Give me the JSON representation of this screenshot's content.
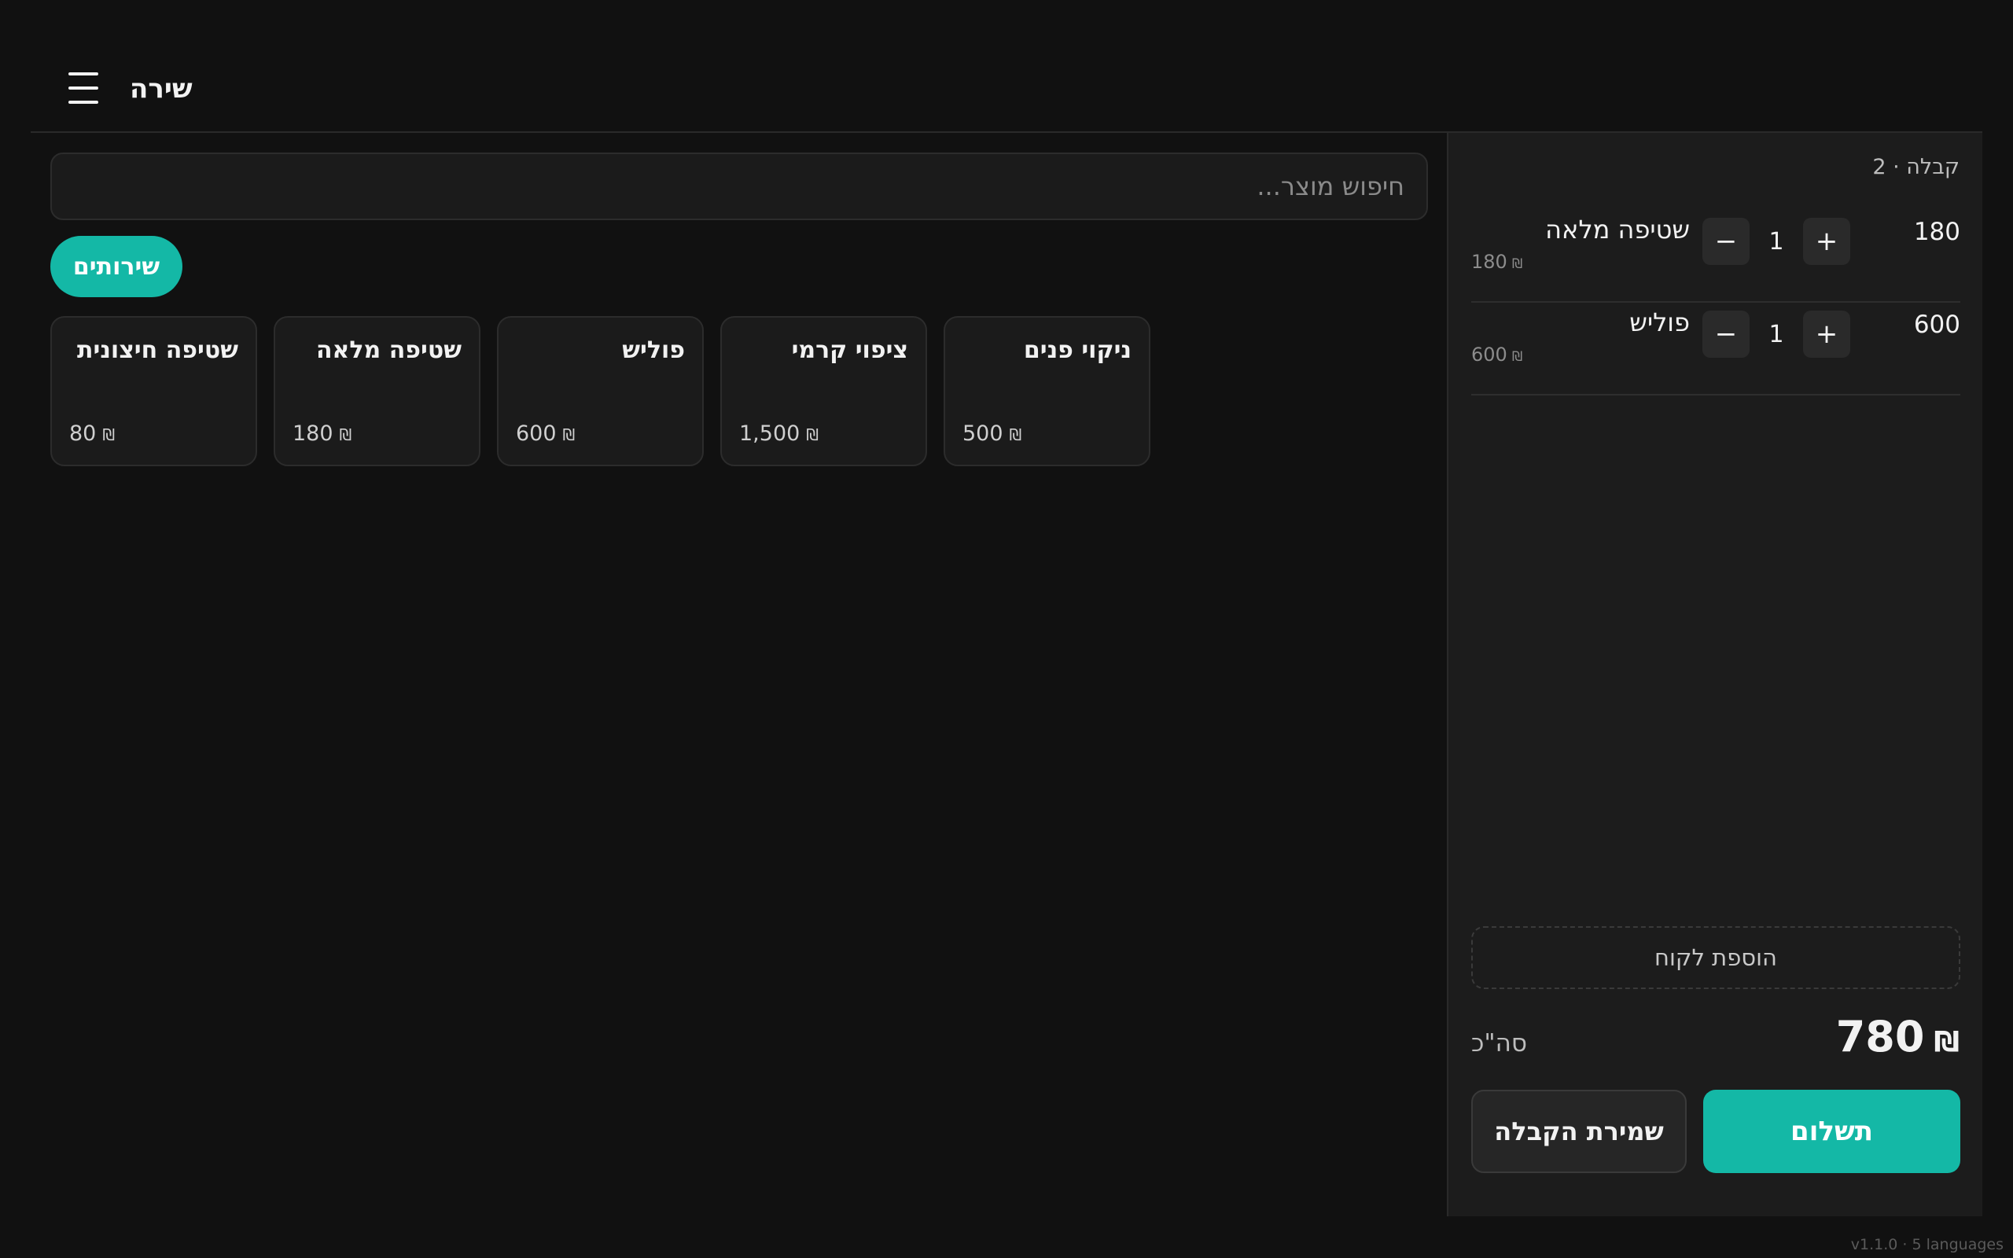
{
  "header": {
    "shop_name": "שירה"
  },
  "search": {
    "placeholder": "חיפוש מוצר..."
  },
  "categories": [
    {
      "label": "שירותים",
      "active": true
    }
  ],
  "products": [
    {
      "name": "ניקוי פנים",
      "price": "500",
      "currency": "₪"
    },
    {
      "name": "ציפוי קרמי",
      "price": "1,500",
      "currency": "₪"
    },
    {
      "name": "פוליש",
      "price": "600",
      "currency": "₪"
    },
    {
      "name": "שטיפה מלאה",
      "price": "180",
      "currency": "₪"
    },
    {
      "name": "שטיפה חיצונית",
      "price": "80",
      "currency": "₪"
    }
  ],
  "receipt": {
    "title": "קבלה · 2",
    "lines": [
      {
        "name": "שטיפה מלאה",
        "unit_price": "180",
        "currency": "₪",
        "qty": "1",
        "total": "180"
      },
      {
        "name": "פוליש",
        "unit_price": "600",
        "currency": "₪",
        "qty": "1",
        "total": "600"
      }
    ],
    "add_customer_label": "הוספת לקוח",
    "total_label": "סה\"כ",
    "total_value": "780",
    "total_currency": "₪",
    "save_label": "שמירת הקבלה",
    "pay_label": "תשלום",
    "minus_symbol": "−",
    "plus_symbol": "+"
  },
  "footer": {
    "version": "v1.1.0 · 5 languages"
  },
  "colors": {
    "accent": "#14b8a6",
    "background": "#111111",
    "panel": "#1c1c1c"
  }
}
